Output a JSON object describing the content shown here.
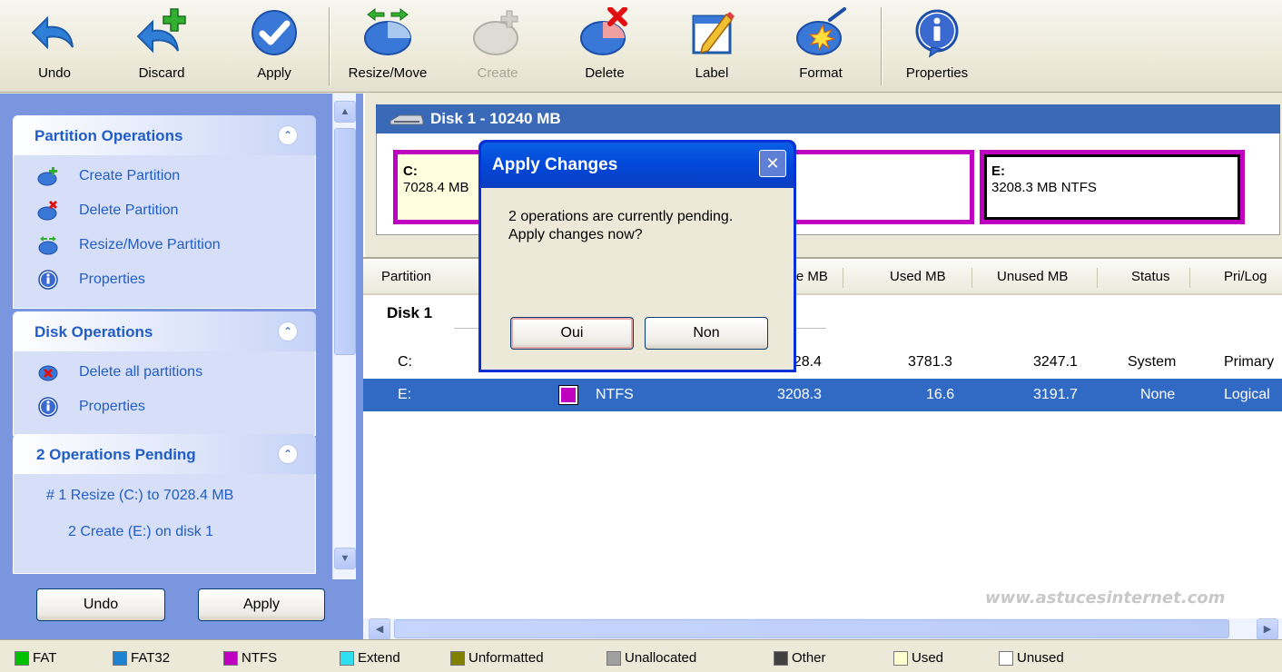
{
  "toolbar": {
    "undo": "Undo",
    "discard": "Discard",
    "apply": "Apply",
    "resize_move": "Resize/Move",
    "create": "Create",
    "delete": "Delete",
    "label": "Label",
    "format": "Format",
    "properties": "Properties"
  },
  "taskpane": {
    "partition_ops": {
      "title": "Partition Operations",
      "items": [
        "Create Partition",
        "Delete Partition",
        "Resize/Move Partition",
        "Properties"
      ]
    },
    "disk_ops": {
      "title": "Disk Operations",
      "items": [
        "Delete all partitions",
        "Properties"
      ]
    },
    "pending": {
      "title": "2 Operations Pending",
      "items": [
        "#  1  Resize (C:) to 7028.4 MB",
        "2  Create (E:) on disk 1"
      ]
    },
    "undo_button": "Undo",
    "apply_button": "Apply"
  },
  "disk": {
    "title": "Disk 1 - 10240 MB",
    "partitions": [
      {
        "letter": "C:",
        "info": "7028.4 MB"
      },
      {
        "letter": "E:",
        "info": "3208.3 MB  NTFS"
      }
    ]
  },
  "list": {
    "headers": [
      "Partition",
      "Size MB",
      "Used MB",
      "Unused MB",
      "Status",
      "Pri/Log"
    ],
    "disk_label": "Disk 1",
    "rows": [
      {
        "partition": "C:",
        "fs": "",
        "size": "7028.4",
        "used": "3781.3",
        "unused": "3247.1",
        "status": "System",
        "type": "Primary"
      },
      {
        "partition": "E:",
        "fs": "NTFS",
        "size": "3208.3",
        "used": "16.6",
        "unused": "3191.7",
        "status": "None",
        "type": "Logical"
      }
    ]
  },
  "legend": [
    "FAT",
    "FAT32",
    "NTFS",
    "Extend",
    "Unformatted",
    "Unallocated",
    "Other",
    "Used",
    "Unused"
  ],
  "legend_colors": [
    "#00c000",
    "#1e82d2",
    "#c000c0",
    "#30e0f0",
    "#808000",
    "#a0a0a0",
    "#404040",
    "#ffffd0",
    "#ffffff"
  ],
  "dialog": {
    "title": "Apply Changes",
    "message": "2 operations are currently pending.\nApply changes now?",
    "yes": "Oui",
    "no": "Non"
  },
  "watermark": "www.astucesinternet.com"
}
